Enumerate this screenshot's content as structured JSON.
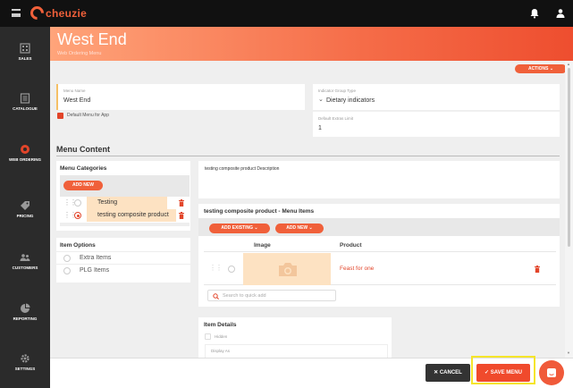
{
  "app": {
    "logo_text": "cheuzie"
  },
  "sidebar": {
    "items": [
      {
        "label": "SALES",
        "icon": "sales-icon"
      },
      {
        "label": "CATALOGUE",
        "icon": "catalogue-icon"
      },
      {
        "label": "WEB ORDERING",
        "icon": "web-ordering-icon"
      },
      {
        "label": "PRICING",
        "icon": "pricing-icon"
      },
      {
        "label": "CUSTOMERS",
        "icon": "customers-icon"
      },
      {
        "label": "REPORTING",
        "icon": "reporting-icon"
      },
      {
        "label": "SETTINGS",
        "icon": "settings-icon"
      }
    ]
  },
  "header": {
    "title": "West End",
    "subtitle": "Web Ordering Menu"
  },
  "actions_label": "ACTIONS",
  "form": {
    "menu_name_label": "Menu Name",
    "menu_name_value": "West End",
    "default_menu_label": "Default Menu for App",
    "indicator_group_label": "Indicator Group Type",
    "indicator_group_value": "Dietary indicators",
    "extras_limit_label": "Default Extras Limit",
    "extras_limit_value": "1"
  },
  "menu_content": {
    "title": "Menu Content",
    "categories_title": "Menu Categories",
    "add_new_label": "ADD NEW",
    "categories": [
      "Testing",
      "testing composite product"
    ],
    "options_title": "Item Options",
    "options": [
      "Extra Items",
      "PLG Items"
    ],
    "description": "testing composite product Description",
    "items_title": "testing composite product - Menu Items",
    "add_existing_label": "ADD EXISTING",
    "add_new_items_label": "ADD NEW",
    "table_headers": [
      "Image",
      "Product"
    ],
    "rows": [
      {
        "product": "Feast for one"
      }
    ],
    "search_placeholder": "Search to quick add",
    "details_title": "Item Details",
    "hidden_label": "Hidden",
    "display_as_label": "Display As"
  },
  "footer": {
    "cancel_label": "CANCEL",
    "save_label": "SAVE MENU"
  },
  "colors": {
    "accent": "#f0603a",
    "highlight": "#f5e52a"
  }
}
